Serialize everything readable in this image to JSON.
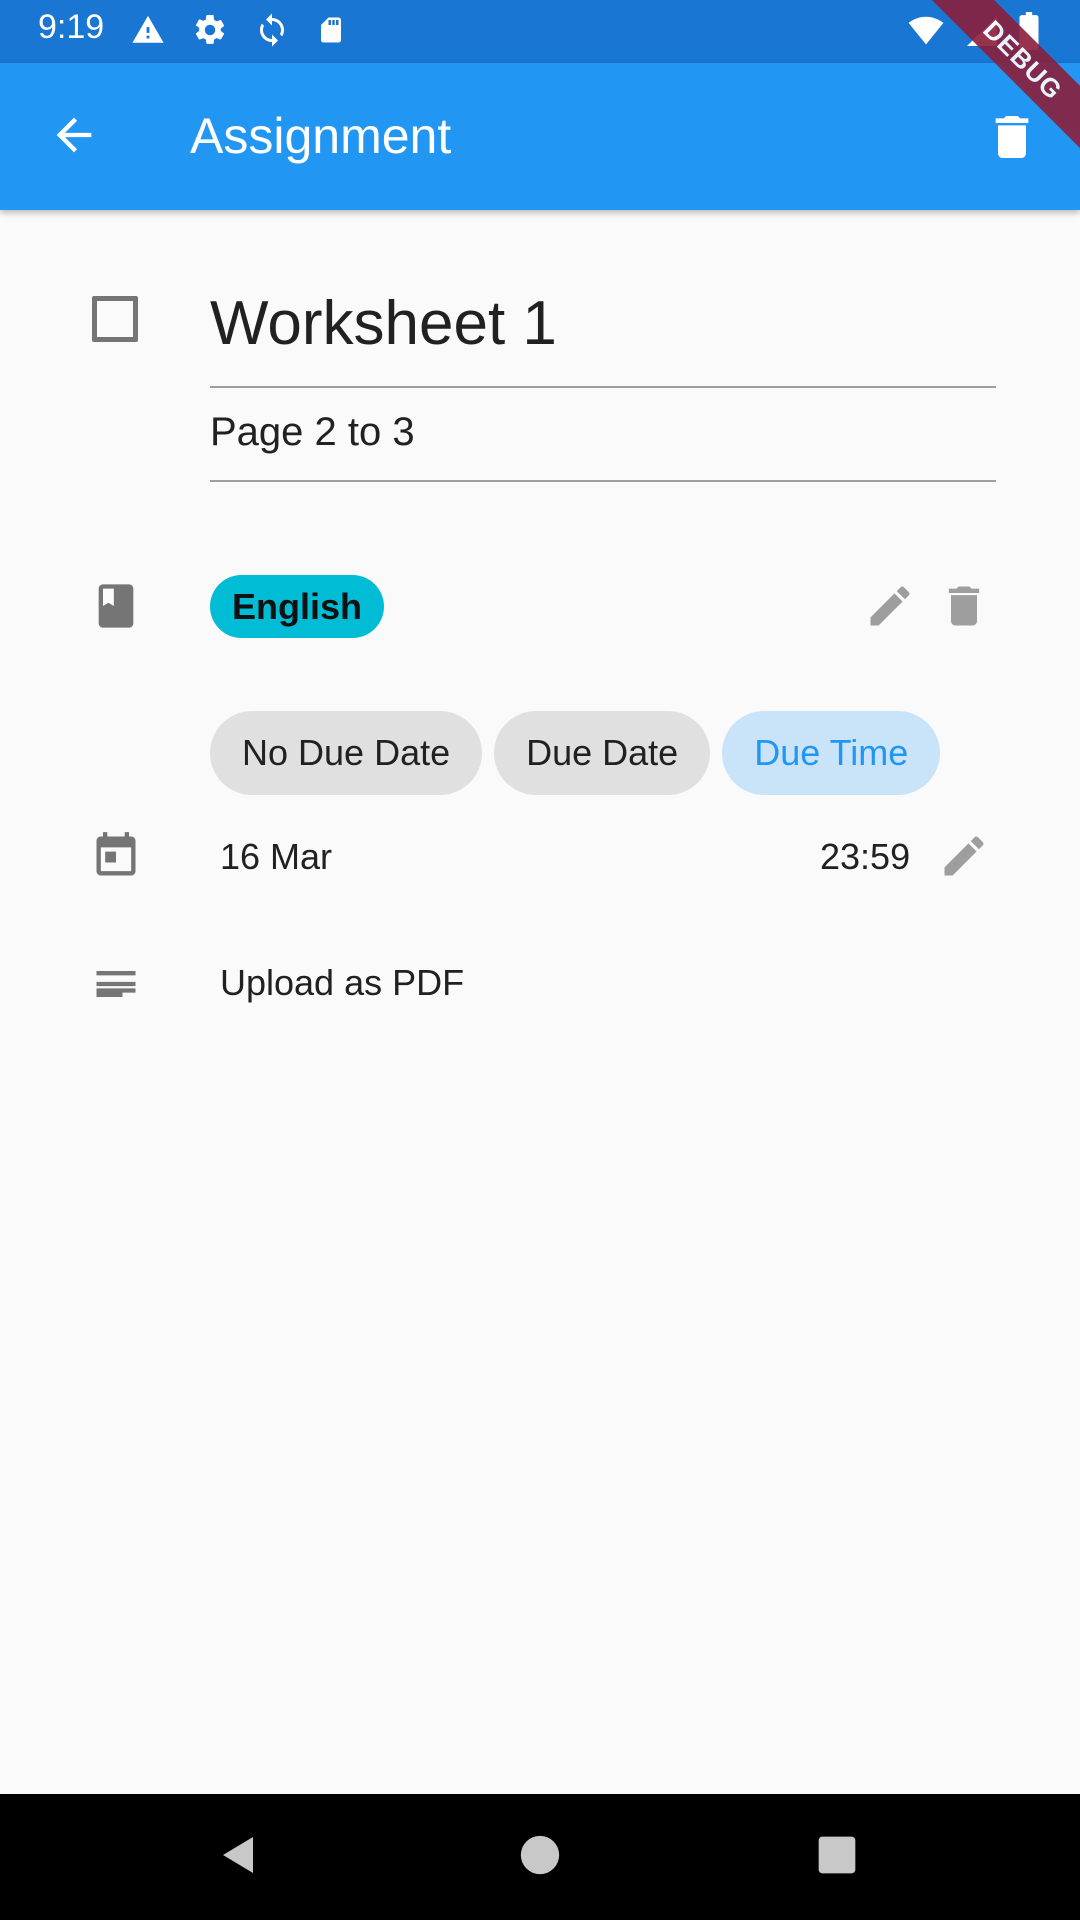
{
  "status_bar": {
    "time": "9:19",
    "icons_left": [
      "warning-icon",
      "settings-icon",
      "sync-icon",
      "sd-card-icon"
    ],
    "icons_right": [
      "wifi-icon",
      "signal-icon",
      "battery-icon"
    ]
  },
  "app_bar": {
    "title": "Assignment",
    "back_icon": "arrow-back-icon",
    "delete_icon": "delete-icon",
    "color": "#2196f3"
  },
  "debug_banner": "DEBUG",
  "assignment": {
    "completed": false,
    "title": "Worksheet 1",
    "description": "Page 2 to 3"
  },
  "subject": {
    "label": "English",
    "color": "#00bcd4"
  },
  "due": {
    "options": [
      "No Due Date",
      "Due Date",
      "Due Time"
    ],
    "selected": "Due Time",
    "date": "16 Mar",
    "time": "23:59"
  },
  "notes": "Upload as PDF"
}
